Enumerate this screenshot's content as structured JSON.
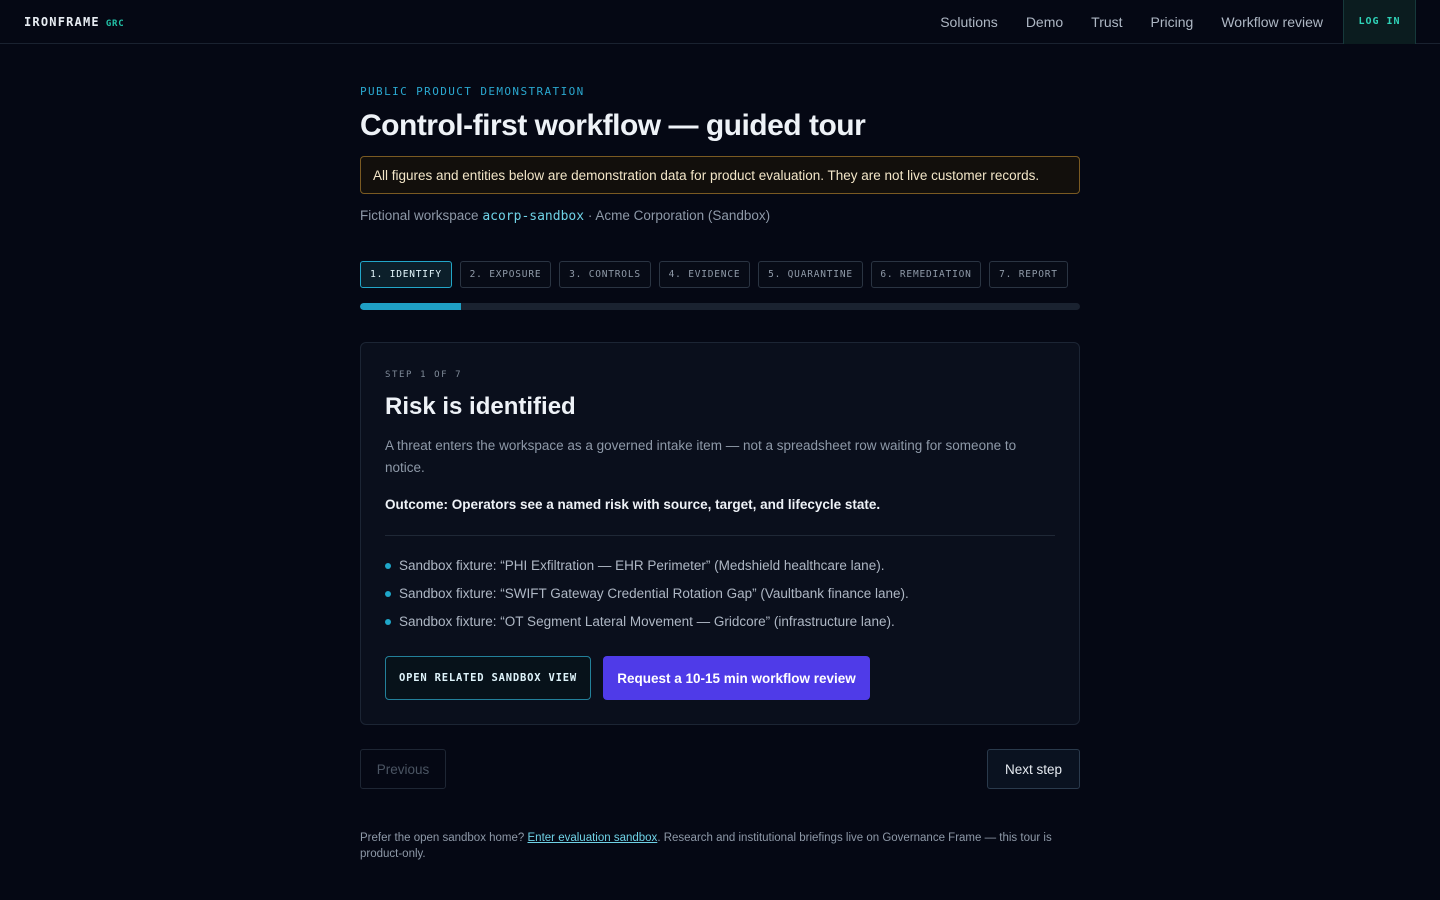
{
  "brand": {
    "name": "IRONFRAME",
    "tag": "GRC"
  },
  "nav": {
    "links": [
      "Solutions",
      "Demo",
      "Trust",
      "Pricing",
      "Workflow review"
    ],
    "login_label": "LOG IN"
  },
  "header": {
    "eyebrow": "PUBLIC PRODUCT DEMONSTRATION",
    "title": "Control-first workflow — guided tour",
    "notice": "All figures and entities below are demonstration data for product evaluation. They are not live customer records.",
    "workspace_prefix": "Fictional workspace ",
    "workspace_code": "acorp-sandbox",
    "workspace_suffix": " · Acme Corporation (Sandbox)"
  },
  "steps": {
    "tabs": [
      "1. IDENTIFY",
      "2. EXPOSURE",
      "3. CONTROLS",
      "4. EVIDENCE",
      "5. QUARANTINE",
      "6. REMEDIATION",
      "7. REPORT"
    ],
    "active_index": 0,
    "progress_fraction": 0.14
  },
  "card": {
    "step_count": "STEP 1 OF 7",
    "title": "Risk is identified",
    "description": "A threat enters the workspace as a governed intake item — not a spreadsheet row waiting for someone to notice.",
    "outcome": "Outcome: Operators see a named risk with source, target, and lifecycle state.",
    "fixtures": [
      "Sandbox fixture: “PHI Exfiltration — EHR Perimeter” (Medshield healthcare lane).",
      "Sandbox fixture: “SWIFT Gateway Credential Rotation Gap” (Vaultbank finance lane).",
      "Sandbox fixture: “OT Segment Lateral Movement — Gridcore” (infrastructure lane)."
    ],
    "sandbox_button": "OPEN RELATED SANDBOX VIEW",
    "review_button": "Request a 10-15 min workflow review"
  },
  "pager": {
    "previous": "Previous",
    "next": "Next step"
  },
  "footnote": {
    "prefix": "Prefer the open sandbox home? ",
    "link": "Enter evaluation sandbox",
    "suffix": ". Research and institutional briefings live on Governance Frame — this tour is product-only."
  },
  "colors": {
    "background": "#050814",
    "accent_cyan": "#1f9fc4",
    "accent_teal": "#22c1a7",
    "accent_violet": "#4f3be8",
    "notice_border": "#7a5a22"
  }
}
